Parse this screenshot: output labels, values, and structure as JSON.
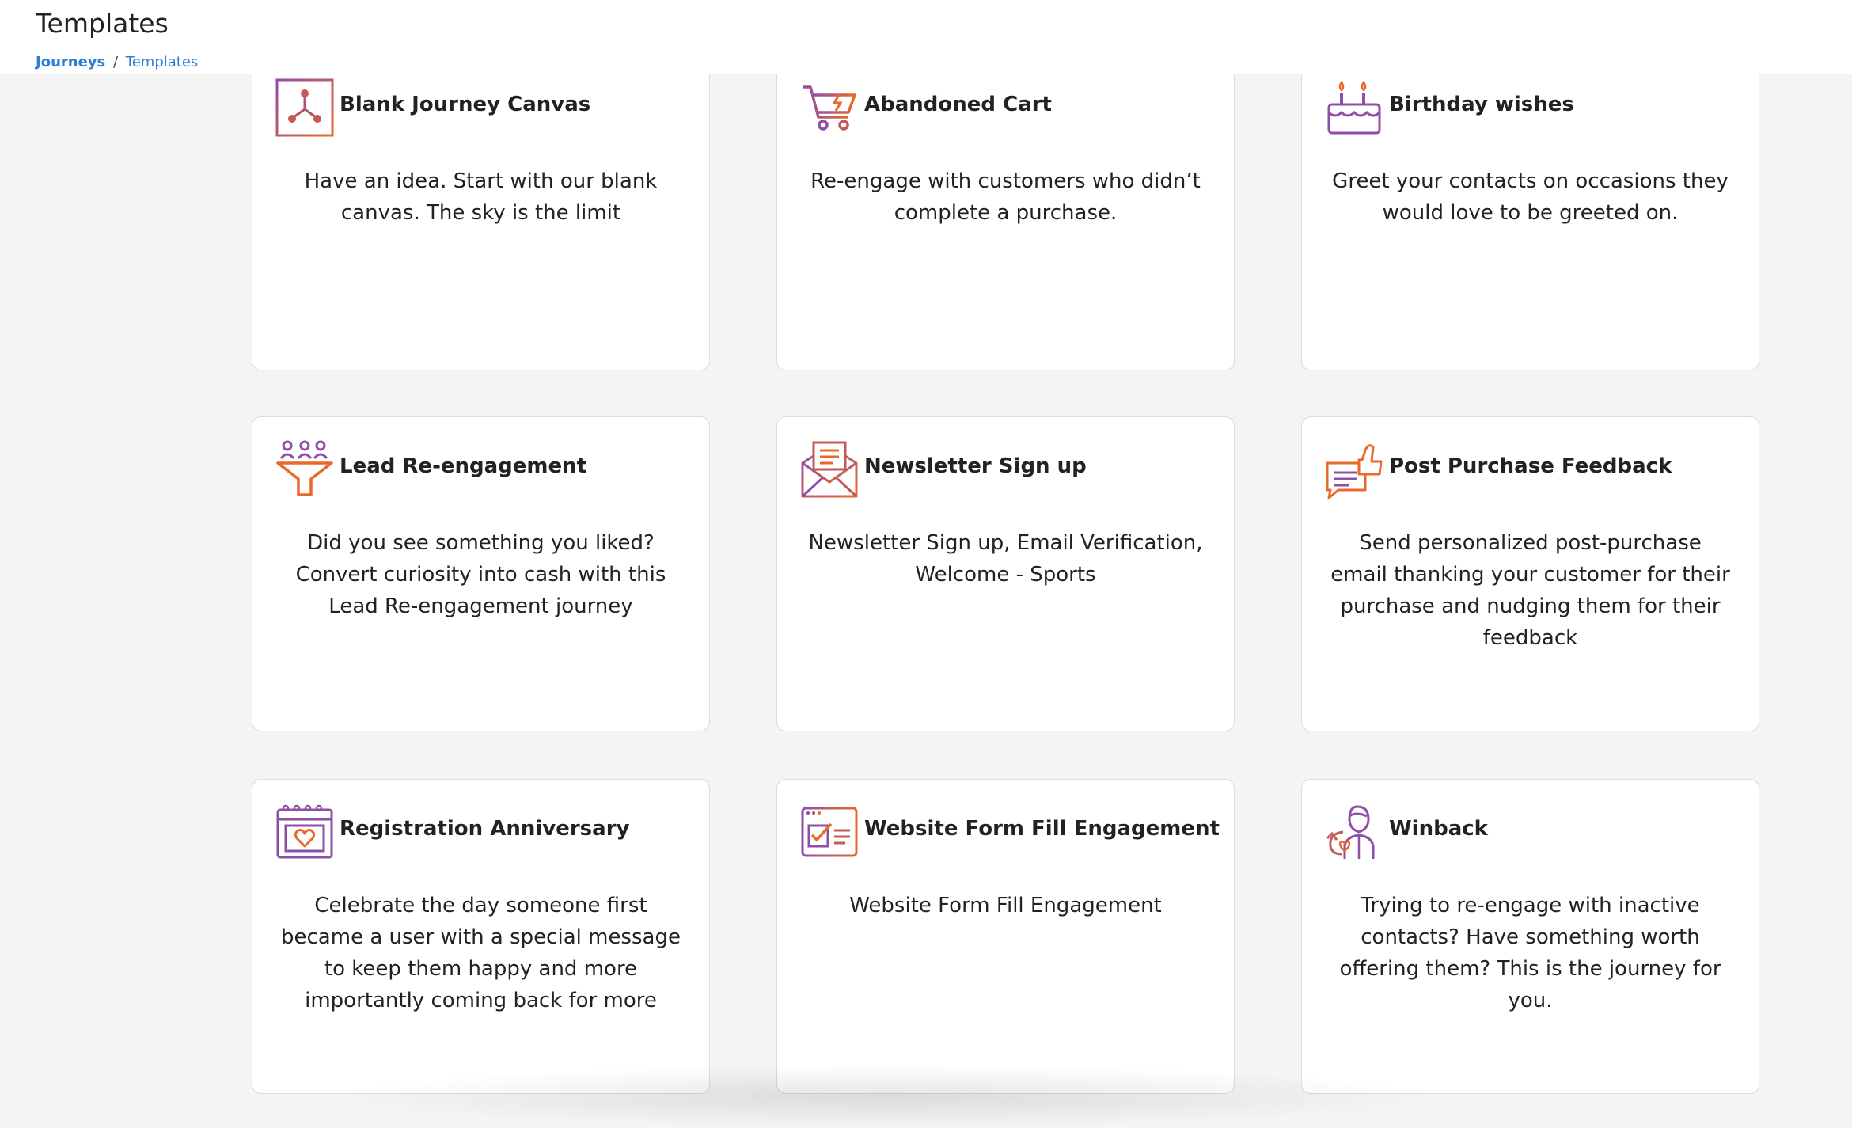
{
  "header": {
    "title": "Templates",
    "breadcrumb": {
      "link": "Journeys",
      "separator": "/",
      "current": "Templates"
    }
  },
  "colors": {
    "link": "#2d7fd6",
    "icon_gradient_start": "#8e4fa8",
    "icon_gradient_end": "#e8692a"
  },
  "cards": [
    {
      "icon": "blank-canvas-icon",
      "title": "Blank Journey Canvas",
      "description": "Have an idea. Start with our blank canvas. The sky is the limit"
    },
    {
      "icon": "shopping-cart-icon",
      "title": "Abandoned Cart",
      "description": "Re-engage with customers who didn’t complete a purchase."
    },
    {
      "icon": "birthday-cake-icon",
      "title": "Birthday wishes",
      "description": "Greet your contacts on occasions they would love to be greeted on."
    },
    {
      "icon": "funnel-people-icon",
      "title": "Lead Re-engagement",
      "description": "Did you see something you liked? Convert curiosity into cash with this Lead Re-engagement journey"
    },
    {
      "icon": "envelope-icon",
      "title": "Newsletter Sign up",
      "description": "Newsletter Sign up, Email Verification, Welcome - Sports"
    },
    {
      "icon": "thumbs-up-chat-icon",
      "title": "Post Purchase Feedback",
      "description": "Send personalized post-purchase email thanking your customer for their purchase and nudging them for their feedback"
    },
    {
      "icon": "calendar-heart-icon",
      "title": "Registration Anniversary",
      "description": "Celebrate the day someone first became a user with a special message to keep them happy and more importantly coming back for more"
    },
    {
      "icon": "web-form-icon",
      "title": "Website Form Fill Engagement",
      "description": "Website Form Fill Engagement"
    },
    {
      "icon": "winback-person-icon",
      "title": "Winback",
      "description": "Trying to re-engage with inactive contacts? Have something worth offering them? This is the journey for you."
    }
  ]
}
